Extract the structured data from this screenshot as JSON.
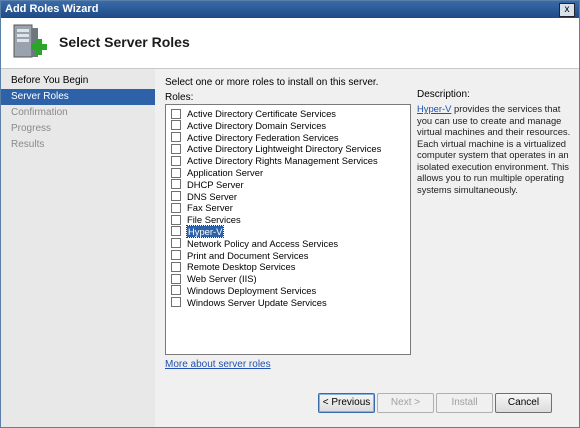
{
  "window": {
    "title": "Add Roles Wizard",
    "close_glyph": "x"
  },
  "header": {
    "title": "Select Server Roles",
    "icon": "server-add-icon"
  },
  "nav": {
    "items": [
      {
        "label": "Before You Begin",
        "state": "done"
      },
      {
        "label": "Server Roles",
        "state": "active"
      },
      {
        "label": "Confirmation",
        "state": "pending"
      },
      {
        "label": "Progress",
        "state": "pending"
      },
      {
        "label": "Results",
        "state": "pending"
      }
    ]
  },
  "content": {
    "instruction": "Select one or more roles to install on this server.",
    "roles_label": "Roles:",
    "roles": [
      {
        "label": "Active Directory Certificate Services",
        "checked": false
      },
      {
        "label": "Active Directory Domain Services",
        "checked": false
      },
      {
        "label": "Active Directory Federation Services",
        "checked": false
      },
      {
        "label": "Active Directory Lightweight Directory Services",
        "checked": false
      },
      {
        "label": "Active Directory Rights Management Services",
        "checked": false
      },
      {
        "label": "Application Server",
        "checked": false
      },
      {
        "label": "DHCP Server",
        "checked": false
      },
      {
        "label": "DNS Server",
        "checked": false
      },
      {
        "label": "Fax Server",
        "checked": false
      },
      {
        "label": "File Services",
        "checked": false
      },
      {
        "label": "Hyper-V",
        "checked": false,
        "selected": true
      },
      {
        "label": "Network Policy and Access Services",
        "checked": false
      },
      {
        "label": "Print and Document Services",
        "checked": false
      },
      {
        "label": "Remote Desktop Services",
        "checked": false
      },
      {
        "label": "Web Server (IIS)",
        "checked": false
      },
      {
        "label": "Windows Deployment Services",
        "checked": false
      },
      {
        "label": "Windows Server Update Services",
        "checked": false
      }
    ],
    "description_title": "Description:",
    "description_link": "Hyper-V",
    "description_text": " provides the services that you can use to create and manage virtual machines and their resources. Each virtual machine is a virtualized computer system that operates in an isolated execution environment. This allows you to run multiple operating systems simultaneously.",
    "more_link": "More about server roles"
  },
  "buttons": {
    "previous": "< Previous",
    "next": "Next >",
    "install": "Install",
    "cancel": "Cancel"
  }
}
